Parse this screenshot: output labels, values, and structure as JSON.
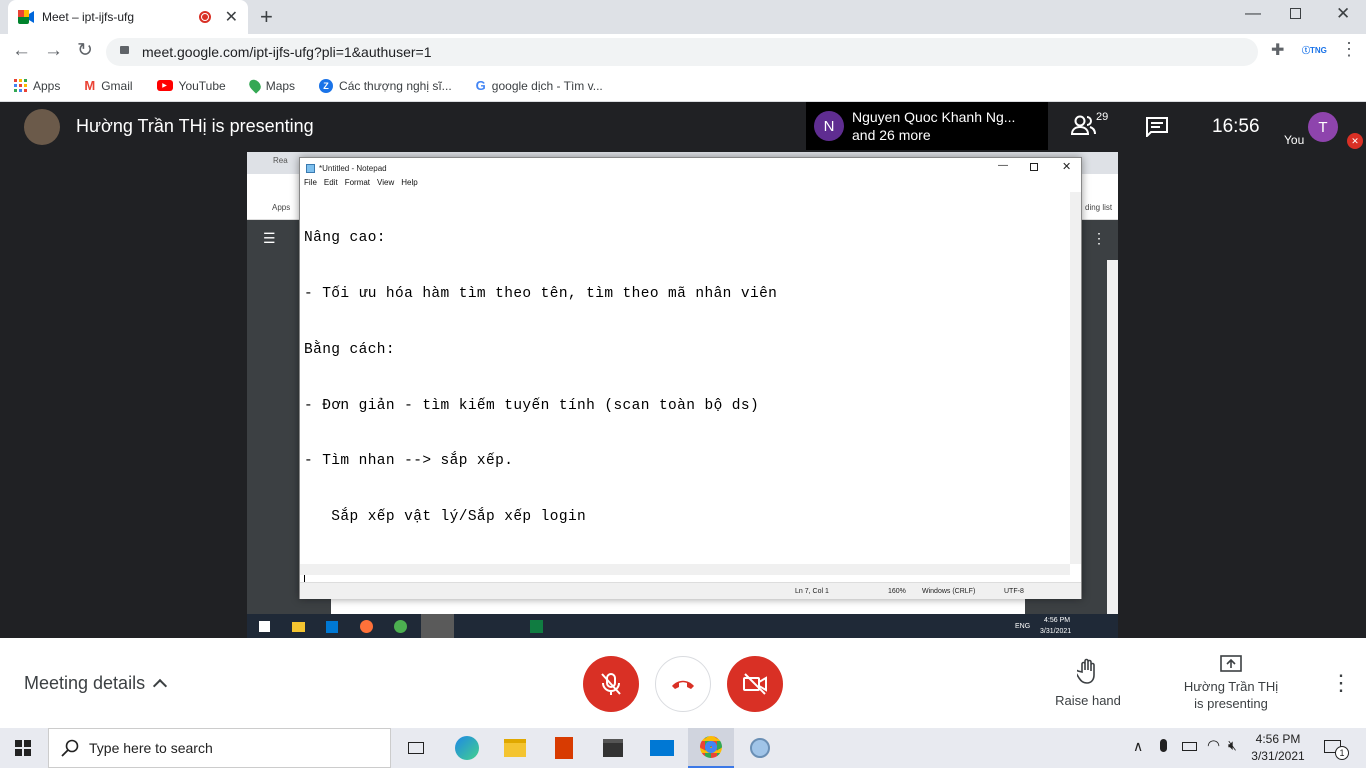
{
  "browser": {
    "tab_title": "Meet – ipt-ijfs-ufg",
    "url": "meet.google.com/ipt-ijfs-ufg?pli=1&authuser=1",
    "bookmarks": [
      "Apps",
      "Gmail",
      "YouTube",
      "Maps",
      "Các thượng nghị sĩ...",
      "google dịch - Tìm v..."
    ]
  },
  "meet": {
    "presenter_banner": "Hường Trần THị is presenting",
    "participant_initial": "N",
    "participant_name": "Nguyen Quoc Khanh Ng...",
    "participant_more": "and 26 more",
    "people_count": "29",
    "clock": "16:56",
    "self_label": "You",
    "self_initial": "T",
    "meeting_details": "Meeting details",
    "raise_hand": "Raise hand",
    "presenting_line1": "Hường Trần THị",
    "presenting_line2": "is presenting"
  },
  "notepad": {
    "title": "*Untitled - Notepad",
    "menu": [
      "File",
      "Edit",
      "Format",
      "View",
      "Help"
    ],
    "lines": [
      "Nâng cao:",
      "- Tối ưu hóa hàm tìm theo tên, tìm theo mã nhân viên",
      "Bằng cách:",
      "- Đơn giản - tìm kiếm tuyến tính (scan toàn bộ ds)",
      "- Tìm nhan --> sắp xếp.",
      "   Sắp xếp vật lý/Sắp xếp login"
    ],
    "status": {
      "position": "Ln 7, Col 1",
      "zoom": "160%",
      "line_ending": "Windows (CRLF)",
      "encoding": "UTF-8"
    }
  },
  "remote": {
    "browser_tab": "Rea",
    "apps": "Apps",
    "side_text": "ding list",
    "lang": "ENG",
    "time": "4:56 PM",
    "date": "3/31/2021"
  },
  "taskbar": {
    "search_placeholder": "Type here to search",
    "time": "4:56 PM",
    "date": "3/31/2021",
    "notifications": "1"
  },
  "colors": {
    "red": "#d93025",
    "meet_dark": "#202124",
    "avatar_purple": "#5f2d91",
    "avatar_self": "#8e44ad"
  }
}
